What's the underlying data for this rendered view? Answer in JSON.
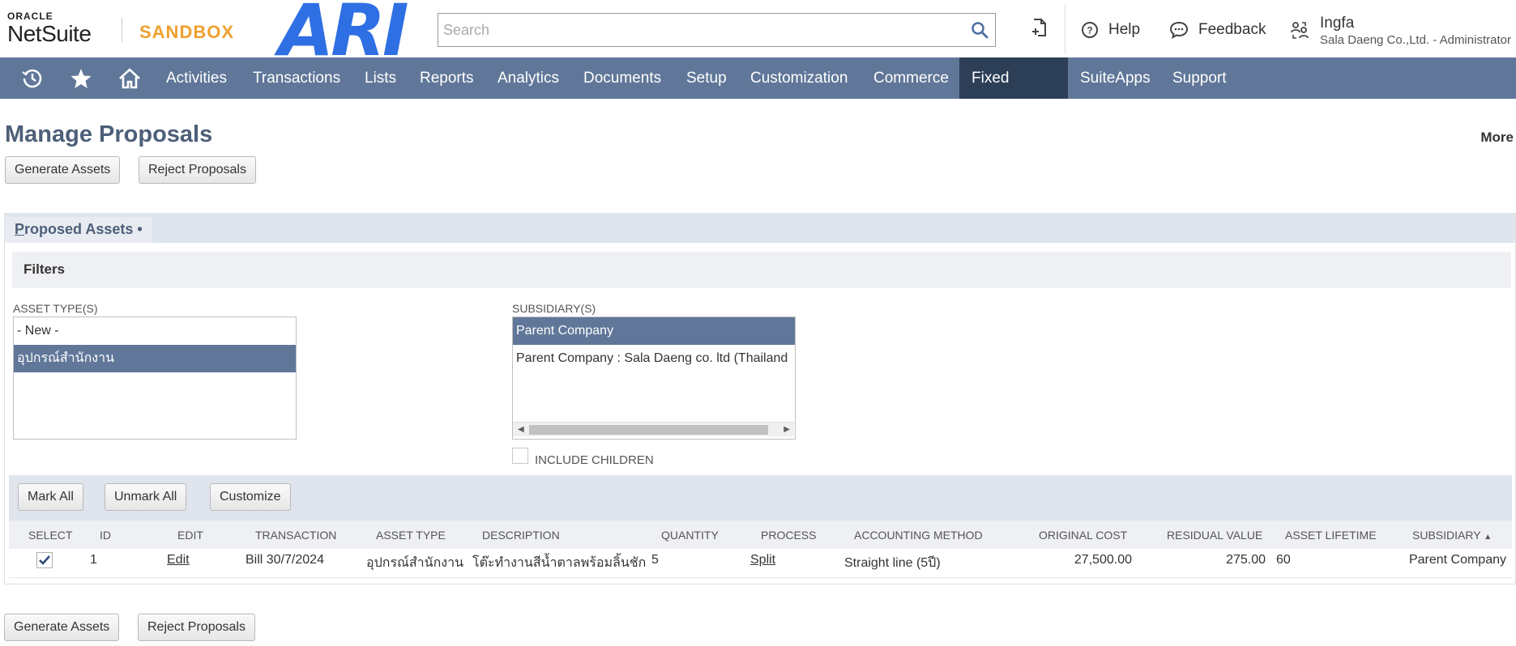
{
  "header": {
    "oracle_text": "ORACLE",
    "netsuite_text": "NetSuite",
    "sandbox_text": "SANDBOX",
    "brand_logo_text": "ARI",
    "search_placeholder": "Search",
    "help_label": "Help",
    "feedback_label": "Feedback",
    "user_name": "Ingfa",
    "user_role": "Sala Daeng Co.,Ltd. - Administrator"
  },
  "nav": {
    "items": [
      "Activities",
      "Transactions",
      "Lists",
      "Reports",
      "Analytics",
      "Documents",
      "Setup",
      "Customization",
      "Commerce",
      "Fixed Assets",
      "SuiteApps",
      "Support"
    ],
    "active": "Fixed Assets"
  },
  "page": {
    "title": "Manage Proposals",
    "more_label": "More",
    "generate_assets": "Generate Assets",
    "reject_proposals": "Reject Proposals"
  },
  "section": {
    "tab_first_letter": "P",
    "tab_rest": "roposed Assets",
    "tab_marker": "•",
    "filters_title": "Filters",
    "asset_types_label": "ASSET TYPE(S)",
    "asset_types": [
      "- New -",
      "อุปกรณ์สำนักงาน"
    ],
    "subsidiaries_label": "SUBSIDIARY(S)",
    "subsidiaries": [
      "Parent Company",
      "Parent Company : Sala Daeng co. ltd (Thailand"
    ],
    "include_children_label": "INCLUDE CHILDREN"
  },
  "list": {
    "mark_all": "Mark All",
    "unmark_all": "Unmark All",
    "customize": "Customize",
    "columns": [
      "SELECT",
      "ID",
      "EDIT",
      "TRANSACTION",
      "ASSET TYPE",
      "DESCRIPTION",
      "QUANTITY",
      "PROCESS",
      "ACCOUNTING METHOD",
      "ORIGINAL COST",
      "RESIDUAL VALUE",
      "ASSET LIFETIME",
      "SUBSIDIARY"
    ],
    "sort_indicator": "▲",
    "rows": [
      {
        "id": "1",
        "edit": "Edit",
        "transaction": "Bill 30/7/2024",
        "asset_type": "อุปกรณ์สำนักงาน",
        "description": "โต๊ะทำงานสีน้ำตาลพร้อมลิ้นชัก",
        "quantity": "5",
        "process": "Split",
        "accounting_method": "Straight line (5ปี)",
        "original_cost": "27,500.00",
        "residual_value": "275.00",
        "asset_lifetime": "60",
        "subsidiary": "Parent Company",
        "selected": true
      }
    ]
  },
  "colors": {
    "nav_bg": "#607799",
    "nav_active_bg": "#2d3e57",
    "title_color": "#4d5f79",
    "sandbox_orange": "#f0a030",
    "ari_blue": "#2f6fe4"
  }
}
